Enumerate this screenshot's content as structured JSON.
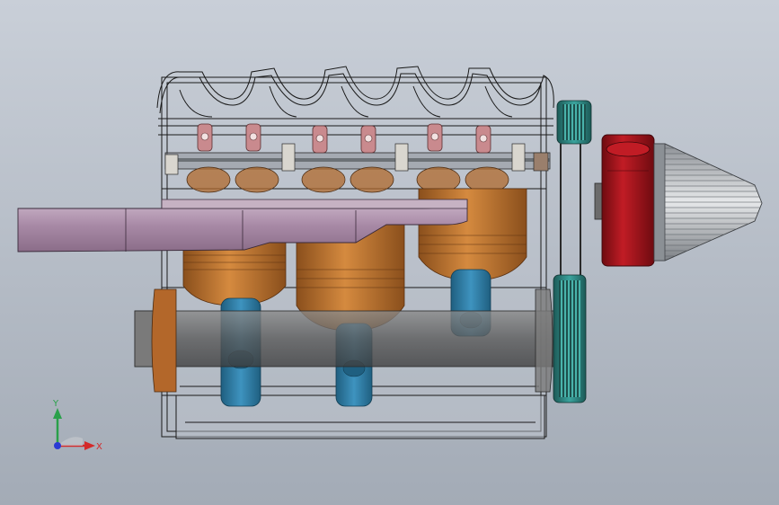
{
  "viewport": {
    "background_top": "#c9cfd8",
    "background_bottom": "#a3abb6"
  },
  "triad": {
    "x_label": "X",
    "y_label": "Y",
    "x_color": "#d42a2a",
    "y_color": "#2aa04a",
    "z_color": "#2a3ad4"
  },
  "model": {
    "cylinder_count": 3,
    "rocker_count": 6,
    "colors": {
      "block_wire": "#1a1a1a",
      "piston": "#c8782f",
      "piston_dark": "#8a4f1c",
      "rod": "#2f7fa8",
      "manifold": "#b49ab0",
      "rocker": "#c98a8e",
      "crank": "#6e6e6e",
      "pulley": "#2e8a85",
      "turbo_red": "#a8141c",
      "filter_silver": "#cfd2d6"
    }
  }
}
